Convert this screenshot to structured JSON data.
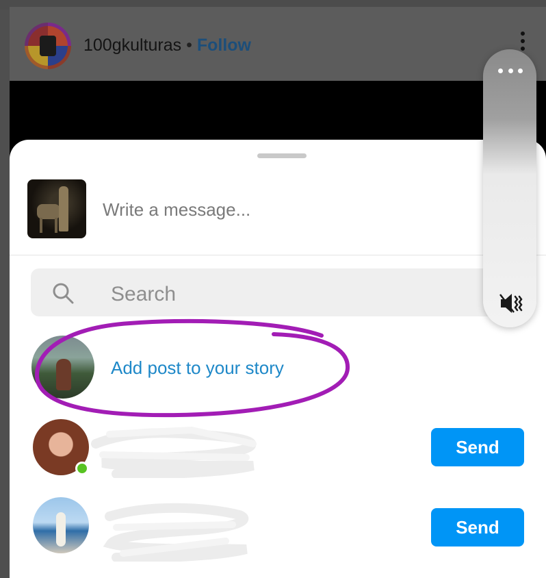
{
  "post": {
    "username": "100gkulturas",
    "separator": "•",
    "follow_label": "Follow"
  },
  "share_sheet": {
    "message_placeholder": "Write a message...",
    "search_placeholder": "Search",
    "story_label": "Add post to your story",
    "contacts": [
      {
        "send_label": "Send",
        "online": true
      },
      {
        "send_label": "Send",
        "online": false
      }
    ]
  },
  "colors": {
    "send_button": "#0095f6",
    "story_link": "#1e88c8",
    "annotation": "#a21db5",
    "online": "#58c322"
  },
  "icons": [
    "search-icon",
    "more-icon",
    "mute-icon",
    "kebab-icon"
  ]
}
